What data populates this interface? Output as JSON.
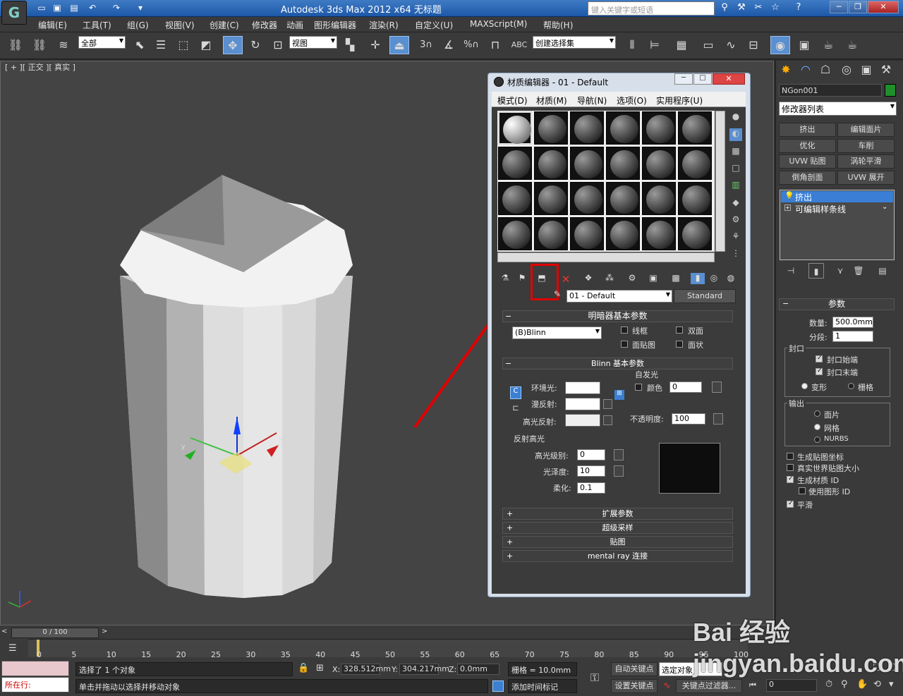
{
  "app": {
    "title": "Autodesk 3ds Max  2012 x64     无标题",
    "search_placeholder": "键入关键字或短语"
  },
  "menu": [
    "编辑(E)",
    "工具(T)",
    "组(G)",
    "视图(V)",
    "创建(C)",
    "修改器",
    "动画",
    "图形编辑器",
    "渲染(R)",
    "自定义(U)",
    "MAXScript(M)",
    "帮助(H)"
  ],
  "toolbar": {
    "selection_filter": "全部",
    "ref_coord": "视图",
    "named_selection": "创建选择集"
  },
  "viewport": {
    "label": "[ + ][ 正交 ][ 真实 ]",
    "axis": {
      "x": "x",
      "y": "y",
      "z": "z"
    }
  },
  "material_editor": {
    "title": "材质编辑器 - 01 - Default",
    "menus": [
      "模式(D)",
      "材质(M)",
      "导航(N)",
      "选项(O)",
      "实用程序(U)"
    ],
    "material_name": "01 - Default",
    "material_type": "Standard",
    "shader_rollout": "明暗器基本参数",
    "shader": "(B)Blinn",
    "wire": "线框",
    "two_sided": "双面",
    "face_map": "面贴图",
    "faceted": "面状",
    "blinn_rollout": "Blinn 基本参数",
    "self_illum": "自发光",
    "color_label": "颜色",
    "color_value": "0",
    "ambient": "环境光:",
    "diffuse": "漫反射:",
    "specular": "高光反射:",
    "opacity_label": "不透明度:",
    "opacity": "100",
    "spec_highlights": "反射高光",
    "spec_level_label": "高光级别:",
    "spec_level": "0",
    "glossiness_label": "光泽度:",
    "glossiness": "10",
    "soften_label": "柔化:",
    "soften": "0.1",
    "rollouts": [
      "扩展参数",
      "超级采样",
      "贴图",
      "mental ray 连接"
    ],
    "highlight_color": "#e00000"
  },
  "command_panel": {
    "object_name": "NGon001",
    "object_color": "#1e8f2a",
    "modifier_list": "修改器列表",
    "buttons": [
      "挤出",
      "编辑面片",
      "优化",
      "车削",
      "UVW 贴图",
      "涡轮平滑",
      "倒角剖面",
      "UVW 展开"
    ],
    "stack": [
      "挤出",
      "可编辑样条线"
    ],
    "params_title": "参数",
    "amount_label": "数量:",
    "amount": "500.0mm",
    "segments_label": "分段:",
    "segments": "1",
    "capping": "封口",
    "cap_start": "封口始端",
    "cap_end": "封口末端",
    "morph": "变形",
    "grid": "栅格",
    "output": "输出",
    "patch": "面片",
    "mesh": "网格",
    "nurbs": "NURBS",
    "gen_mapping": "生成贴图坐标",
    "real_world": "真实世界贴图大小",
    "gen_mat_ids": "生成材质 ID",
    "use_shape_ids": "使用图形 ID",
    "smooth": "平滑"
  },
  "timeline": {
    "frame": "0 / 100",
    "ticks": [
      "0",
      "5",
      "10",
      "15",
      "20",
      "25",
      "30",
      "35",
      "40",
      "45",
      "50",
      "55",
      "60",
      "65",
      "70",
      "75",
      "80",
      "85",
      "90",
      "95",
      "100"
    ]
  },
  "status": {
    "listener": "所在行:",
    "selected": "选择了 1 个对象",
    "prompt": "单击并拖动以选择并移动对象",
    "x_label": "X:",
    "x": "328.512mm",
    "y_label": "Y:",
    "y": "304.217mm",
    "z_label": "Z:",
    "z": "0.0mm",
    "grid": "栅格 = 10.0mm",
    "add_time_tag": "添加时间标记",
    "auto_key": "自动关键点",
    "selected_obj": "选定对象",
    "set_key": "设置关键点",
    "key_filters": "关键点过滤器...",
    "frame": "0"
  },
  "watermark": "Bai 经验  jingyan.baidu.com"
}
